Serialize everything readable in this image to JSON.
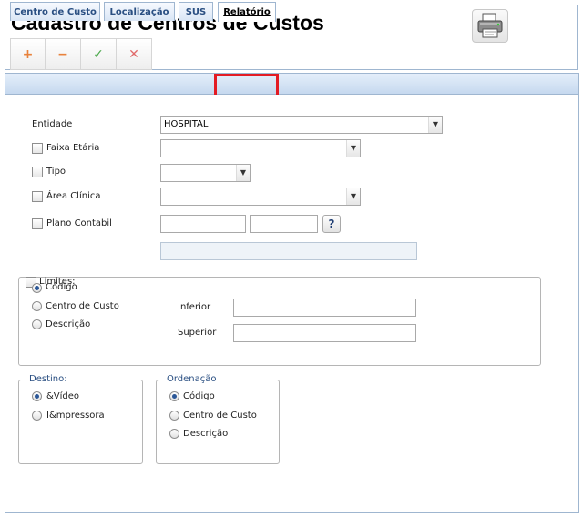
{
  "header": {
    "title": "Cadastro de Centros de Custos",
    "toolbar": [
      {
        "name": "add-button",
        "glyph": "+",
        "color": "#e8823c"
      },
      {
        "name": "remove-button",
        "glyph": "−",
        "color": "#e8823c"
      },
      {
        "name": "confirm-button",
        "glyph": "✓",
        "color": "#4aa84a"
      },
      {
        "name": "cancel-button",
        "glyph": "✕",
        "color": "#e06a6a"
      }
    ]
  },
  "tabs": [
    {
      "label": "Centro de Custo"
    },
    {
      "label": "Localização"
    },
    {
      "label": "SUS"
    },
    {
      "label": "Relatório",
      "active": true
    }
  ],
  "form": {
    "entidade": {
      "label": "Entidade",
      "value": "HOSPITAL"
    },
    "faixa_etaria": {
      "label": "Faixa Etária",
      "checked": false,
      "value": ""
    },
    "tipo": {
      "label": "Tipo",
      "checked": false,
      "value": ""
    },
    "area_clinica": {
      "label": "Área Clínica",
      "checked": false,
      "value": ""
    },
    "plano_contabil": {
      "label": "Plano Contabil",
      "checked": false,
      "lookup_label": "?"
    }
  },
  "limites": {
    "label": "Limites:",
    "options": [
      {
        "label": "Código",
        "selected": true
      },
      {
        "label": "Centro de Custo",
        "selected": false
      },
      {
        "label": "Descrição",
        "selected": false
      }
    ],
    "inferior_label": "Inferior",
    "superior_label": "Superior"
  },
  "destino": {
    "label": "Destino:",
    "options": [
      {
        "label": "&Vídeo",
        "selected": true
      },
      {
        "label": "I&mpressora",
        "selected": false
      }
    ]
  },
  "ordenacao": {
    "label": "Ordenação",
    "options": [
      {
        "label": "Código",
        "selected": true
      },
      {
        "label": "Centro de Custo",
        "selected": false
      },
      {
        "label": "Descrição",
        "selected": false
      }
    ]
  },
  "colors": {
    "accent": "#2a4f82",
    "highlight": "#e31b23",
    "tab_bar": "#c6d9ef"
  }
}
